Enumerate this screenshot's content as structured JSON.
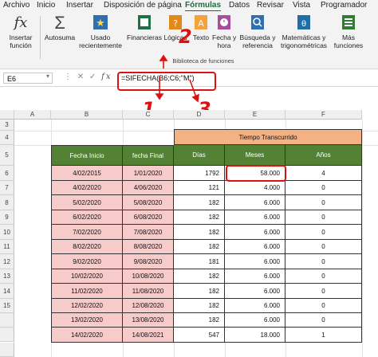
{
  "menu": [
    "Archivo",
    "Inicio",
    "Insertar",
    "Disposición de página",
    "Fórmulas",
    "Datos",
    "Revisar",
    "Vista",
    "Programador"
  ],
  "menu_active": "Fórmulas",
  "ribbon": {
    "insert_function": [
      "Insertar",
      "función"
    ],
    "buttons": [
      {
        "icon": "autosum-icon",
        "lines": [
          "Autosuma",
          ""
        ]
      },
      {
        "icon": "star-icon",
        "lines": [
          "Usado",
          "recientemente"
        ]
      },
      {
        "icon": "finance-book-icon",
        "lines": [
          "Financieras",
          ""
        ]
      },
      {
        "icon": "logic-book-icon",
        "lines": [
          "Lógicas",
          ""
        ]
      },
      {
        "icon": "text-book-icon",
        "lines": [
          "Texto",
          ""
        ]
      },
      {
        "icon": "clock-book-icon",
        "lines": [
          "Fecha y",
          "hora"
        ]
      },
      {
        "icon": "lookup-book-icon",
        "lines": [
          "Búsqueda y",
          "referencia"
        ]
      },
      {
        "icon": "math-book-icon",
        "lines": [
          "Matemáticas y",
          "trigonométricas"
        ]
      },
      {
        "icon": "more-functions-icon",
        "lines": [
          "Más",
          "funciones"
        ]
      }
    ],
    "group_label": "Biblioteca de funciones",
    "colors": {
      "autosum": "#444444",
      "recent": "#2f6fb0",
      "book": "#1e7145",
      "logic": "#e08a1e",
      "text": "#e06a1e",
      "date": "#a64d9b",
      "lookup": "#2f6fb0",
      "math": "#1e6fa8",
      "more": "#2e7d32"
    }
  },
  "formula_bar": {
    "cell_ref": "E6",
    "fx": "fx",
    "formula": "=SIFECHA(B6;C6;\"M\")"
  },
  "annotations": [
    "1",
    "2",
    "3"
  ],
  "sheet": {
    "columns": [
      "A",
      "B",
      "C",
      "D",
      "E",
      "F"
    ],
    "row_numbers": [
      "3",
      "4",
      "5",
      "6",
      "7",
      "8",
      "9",
      "10",
      "11",
      "12",
      "13",
      "14",
      "15"
    ],
    "merged_header": "Tiempo Transcurrido",
    "headers": [
      "Fecha Inicio",
      "fecha Final",
      "Días",
      "Meses",
      "Años"
    ],
    "rows": [
      [
        "4/02/2015",
        "1/01/2020",
        "1792",
        "58.000",
        "4"
      ],
      [
        "4/02/2020",
        "4/06/2020",
        "121",
        "4.000",
        "0"
      ],
      [
        "5/02/2020",
        "5/08/2020",
        "182",
        "6.000",
        "0"
      ],
      [
        "6/02/2020",
        "6/08/2020",
        "182",
        "6.000",
        "0"
      ],
      [
        "7/02/2020",
        "7/08/2020",
        "182",
        "6.000",
        "0"
      ],
      [
        "8/02/2020",
        "8/08/2020",
        "182",
        "6.000",
        "0"
      ],
      [
        "9/02/2020",
        "9/08/2020",
        "181",
        "6.000",
        "0"
      ],
      [
        "10/02/2020",
        "10/08/2020",
        "182",
        "6.000",
        "0"
      ],
      [
        "11/02/2020",
        "11/08/2020",
        "182",
        "6.000",
        "0"
      ],
      [
        "12/02/2020",
        "12/08/2020",
        "182",
        "6.000",
        "0"
      ],
      [
        "13/02/2020",
        "13/08/2020",
        "182",
        "6.000",
        "0"
      ],
      [
        "14/02/2020",
        "14/08/2021",
        "547",
        "18.000",
        "1"
      ]
    ],
    "colors": {
      "header_green": "#548235",
      "pink": "#f8cbcb",
      "salmon": "#f4b184",
      "highlight": "#dd1111"
    }
  }
}
